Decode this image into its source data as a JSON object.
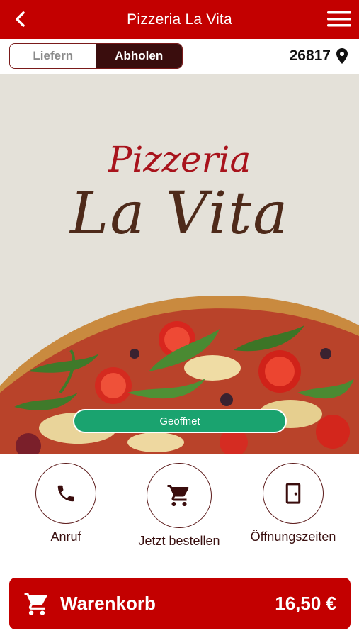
{
  "header": {
    "title": "Pizzeria La Vita",
    "back_icon": "chevron-left-icon",
    "menu_icon": "hamburger-menu-icon"
  },
  "order_mode": {
    "options": [
      "Liefern",
      "Abholen"
    ],
    "selected": "Abholen"
  },
  "location": {
    "postal_code": "26817",
    "icon": "location-pin-icon"
  },
  "hero": {
    "logo_line1": "Pizzeria",
    "logo_line2": "La Vita",
    "status": "Geöffnet",
    "status_color": "#1aa36f"
  },
  "actions": [
    {
      "label": "Anruf",
      "icon": "phone-icon"
    },
    {
      "label": "Jetzt bestellen",
      "icon": "shopping-cart-icon"
    },
    {
      "label": "Öffnungszeiten",
      "icon": "door-icon"
    }
  ],
  "cart": {
    "label": "Warenkorb",
    "total": "16,50 €",
    "icon": "shopping-cart-icon"
  },
  "colors": {
    "brand": "#c30000",
    "dark": "#3a0d0d",
    "hero_bg": "#e4e1d9"
  }
}
